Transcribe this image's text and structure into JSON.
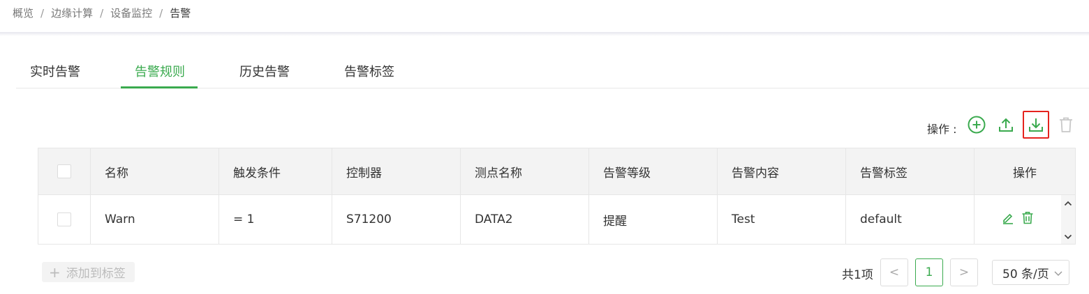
{
  "breadcrumb": [
    "概览",
    "边缘计算",
    "设备监控",
    "告警"
  ],
  "breadcrumb_separator": "/",
  "tabs": [
    {
      "label": "实时告警"
    },
    {
      "label": "告警规则",
      "active": true
    },
    {
      "label": "历史告警"
    },
    {
      "label": "告警标签"
    }
  ],
  "toolbar": {
    "label": "操作 :",
    "icons": [
      "add-circle-icon",
      "upload-icon",
      "download-icon",
      "trash-icon"
    ],
    "highlighted": "download-icon"
  },
  "table": {
    "headers": [
      "名称",
      "触发条件",
      "控制器",
      "测点名称",
      "告警等级",
      "告警内容",
      "告警标签",
      "操作"
    ],
    "rows": [
      {
        "name": "Warn",
        "condition": "= 1",
        "controller": "S71200",
        "point": "DATA2",
        "level": "提醒",
        "content": "Test",
        "tag": "default"
      }
    ],
    "row_action_icons": [
      "edit-icon",
      "trash-icon"
    ]
  },
  "add_tag": {
    "plus": "+",
    "label": "添加到标签"
  },
  "pagination": {
    "total": "共1项",
    "prev": "<",
    "current": "1",
    "next": ">",
    "page_size": "50 条/页"
  },
  "colors": {
    "accent": "#3aaa4e",
    "highlight_border": "#e5231d",
    "header_bg": "#f3f3f3"
  }
}
